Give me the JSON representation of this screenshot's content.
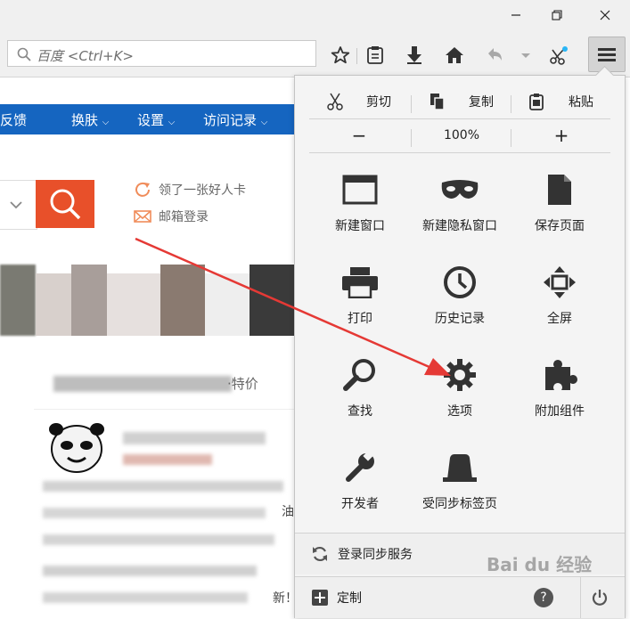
{
  "browser": {
    "search_placeholder": "百度 <Ctrl+K>"
  },
  "webpage": {
    "nav": [
      "反馈",
      "换肤",
      "设置",
      "访问记录"
    ],
    "side_links": [
      "领了一张好人卡",
      "邮箱登录"
    ],
    "partial_text": [
      "·特价",
      "油",
      "新！"
    ]
  },
  "menu": {
    "edit": {
      "cut": "剪切",
      "copy": "复制",
      "paste": "粘贴"
    },
    "zoom": {
      "minus": "−",
      "level": "100%",
      "plus": "+"
    },
    "tiles": [
      {
        "label": "新建窗口",
        "icon": "new-window-icon"
      },
      {
        "label": "新建隐私窗口",
        "icon": "private-mask-icon"
      },
      {
        "label": "保存页面",
        "icon": "save-page-icon"
      },
      {
        "label": "打印",
        "icon": "printer-icon"
      },
      {
        "label": "历史记录",
        "icon": "history-clock-icon"
      },
      {
        "label": "全屏",
        "icon": "fullscreen-icon"
      },
      {
        "label": "查找",
        "icon": "magnifier-icon"
      },
      {
        "label": "选项",
        "icon": "gear-icon"
      },
      {
        "label": "附加组件",
        "icon": "puzzle-icon"
      },
      {
        "label": "开发者",
        "icon": "wrench-icon"
      },
      {
        "label": "受同步标签页",
        "icon": "synced-tabs-icon"
      }
    ],
    "sync": "登录同步服务",
    "customize": "定制"
  },
  "watermark": "Bai du 经验",
  "colors": {
    "nav_blue": "#1565c0",
    "search_orange": "#e8502a",
    "annotation_red": "#e53935"
  }
}
